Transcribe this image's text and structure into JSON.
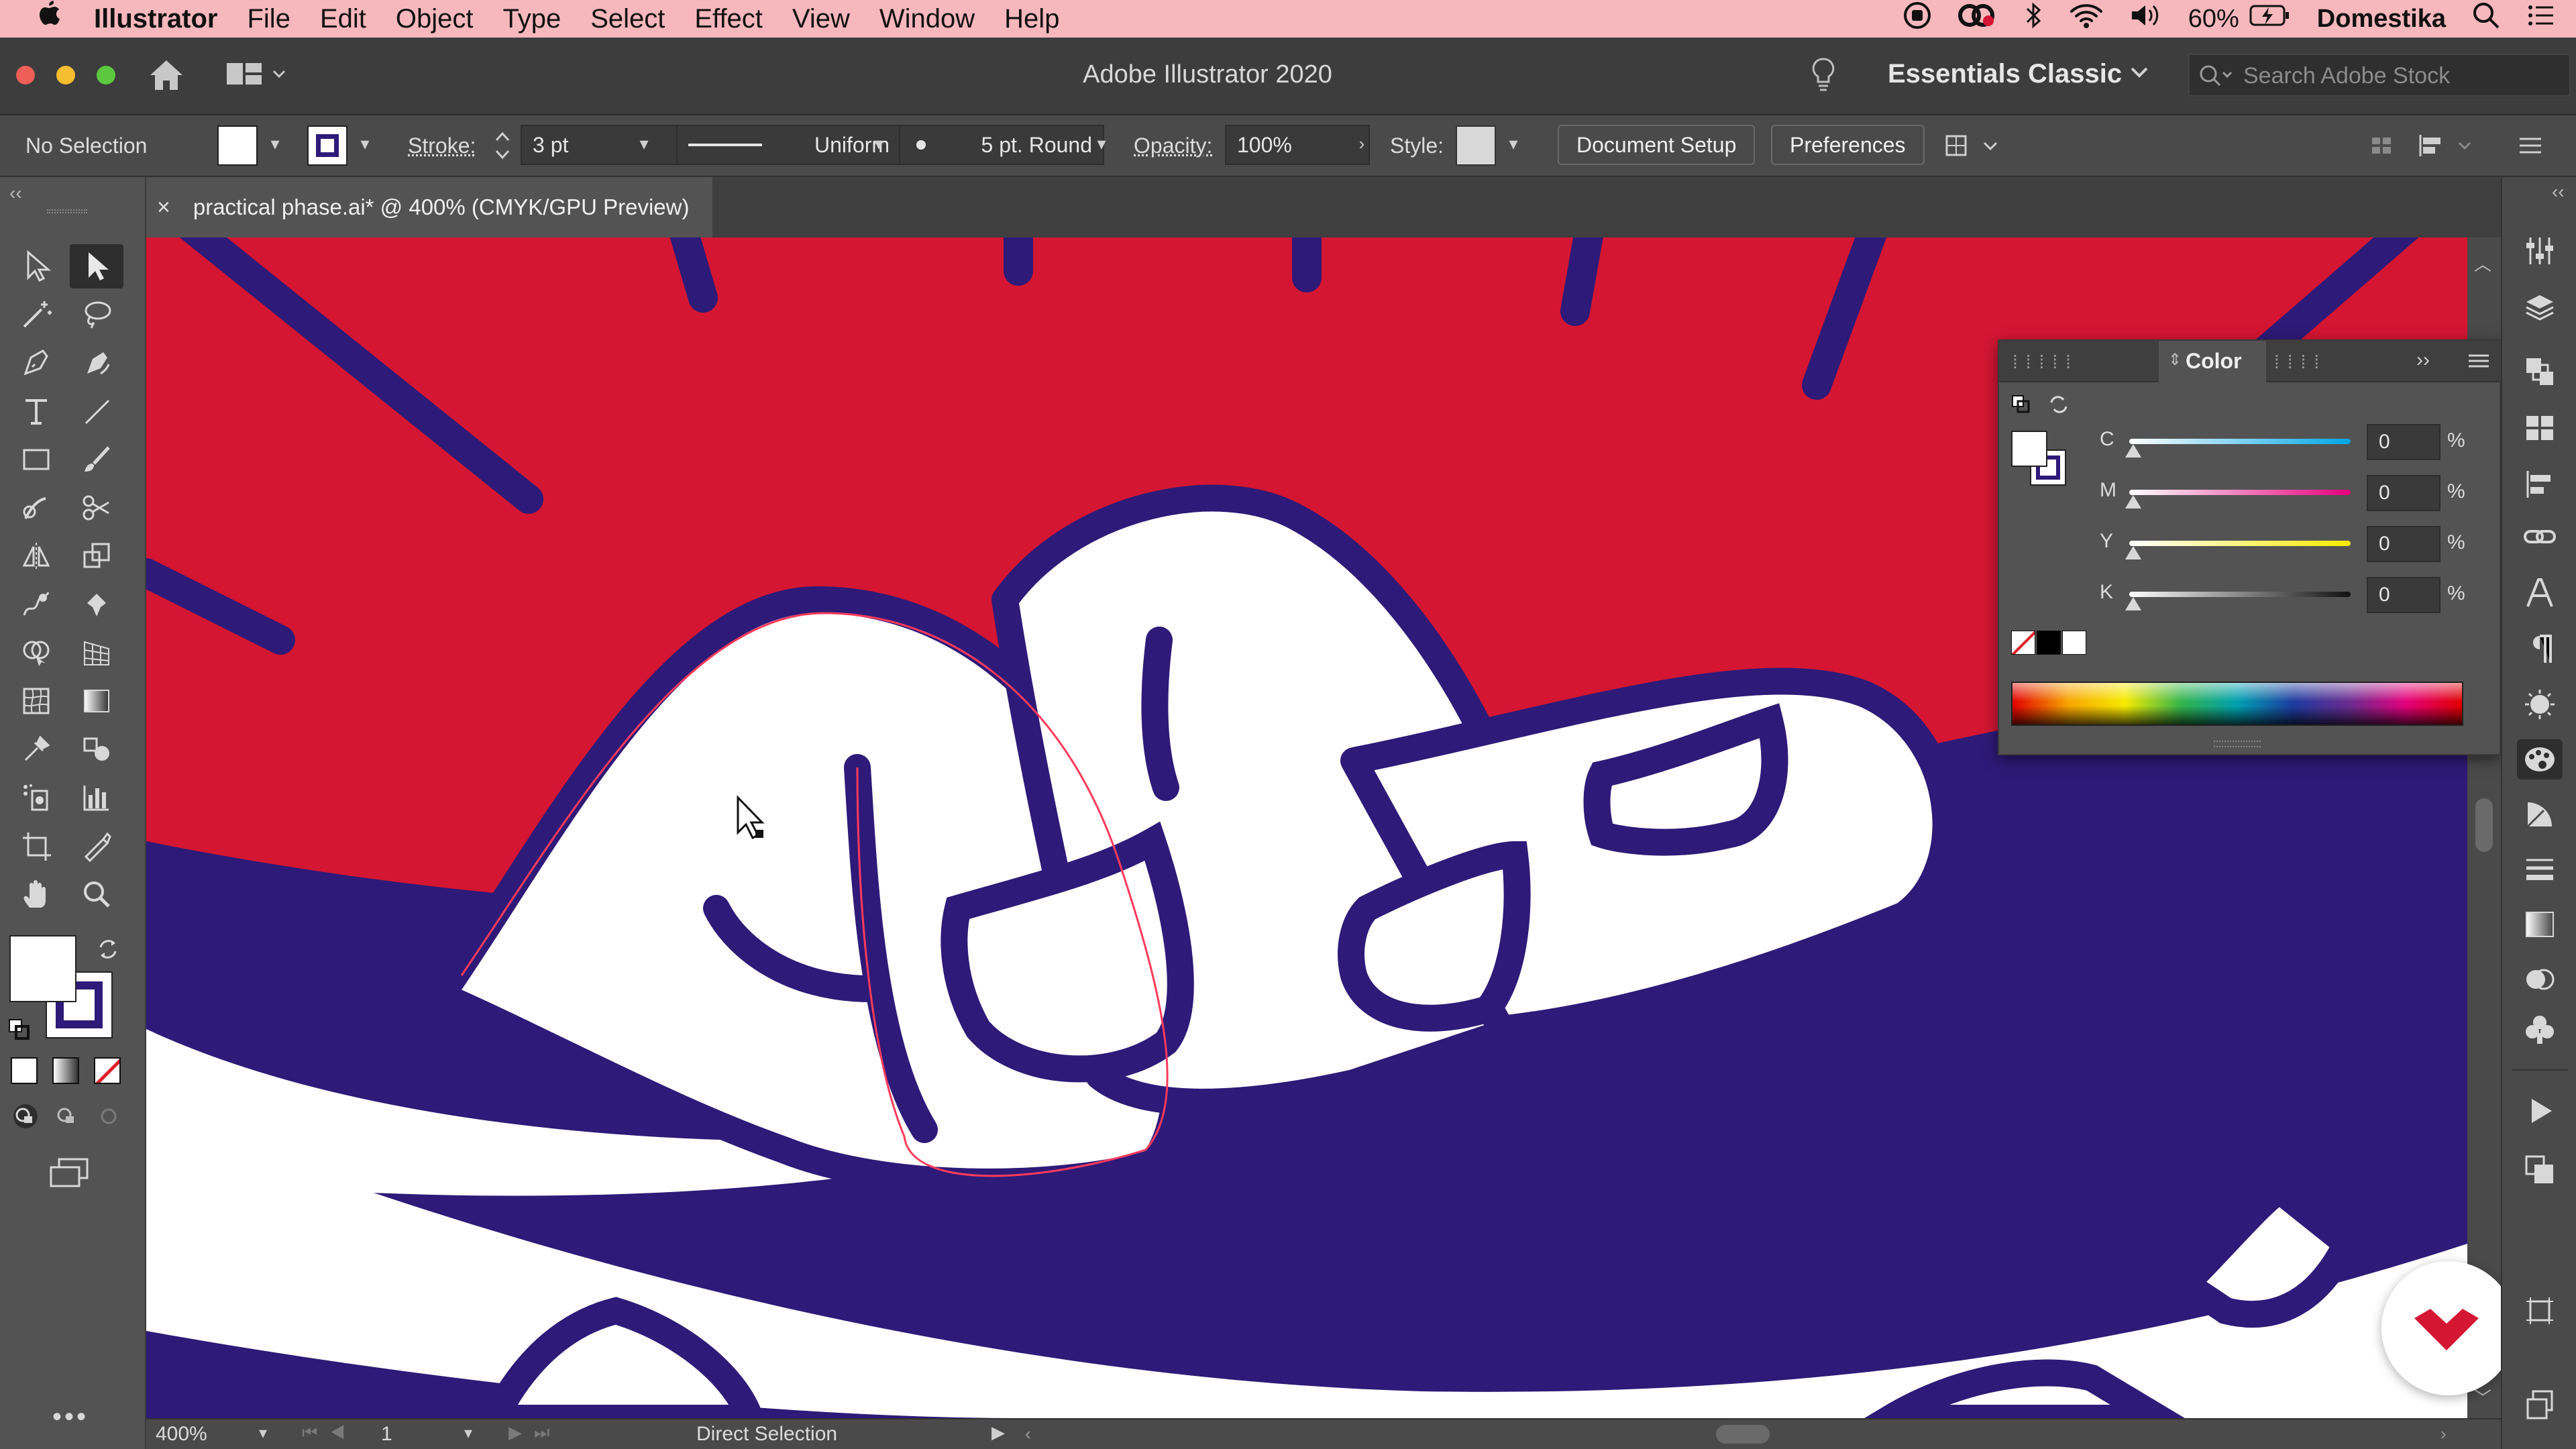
{
  "menubar": {
    "app_name": "Illustrator",
    "items": [
      "File",
      "Edit",
      "Object",
      "Type",
      "Select",
      "Effect",
      "View",
      "Window",
      "Help"
    ],
    "battery": "60%",
    "user": "Domestika"
  },
  "header": {
    "title": "Adobe Illustrator 2020",
    "workspace": "Essentials Classic",
    "search_placeholder": "Search Adobe Stock"
  },
  "control_bar": {
    "selection": "No Selection",
    "stroke_label": "Stroke:",
    "stroke_value": "3 pt",
    "profile": "Uniform",
    "brush": "5 pt. Round",
    "opacity_label": "Opacity:",
    "opacity_value": "100%",
    "style_label": "Style:",
    "document_setup": "Document Setup",
    "preferences": "Preferences",
    "fill_color": "#ffffff",
    "stroke_color": "#2e1a78"
  },
  "document": {
    "tab_title": "practical phase.ai* @ 400% (CMYK/GPU Preview)"
  },
  "color_panel": {
    "title": "Color",
    "channels": [
      {
        "label": "C",
        "value": "0",
        "unit": "%"
      },
      {
        "label": "M",
        "value": "0",
        "unit": "%"
      },
      {
        "label": "Y",
        "value": "0",
        "unit": "%"
      },
      {
        "label": "K",
        "value": "0",
        "unit": "%"
      }
    ]
  },
  "status_bar": {
    "zoom": "400%",
    "artboard": "1",
    "tool_name": "Direct Selection"
  },
  "colors": {
    "artwork_red": "#d41632",
    "artwork_purple": "#2e1a78",
    "artwork_white": "#ffffff",
    "selection_highlight": "#ff3b5c",
    "menubar_pink": "#f6b8bd"
  }
}
